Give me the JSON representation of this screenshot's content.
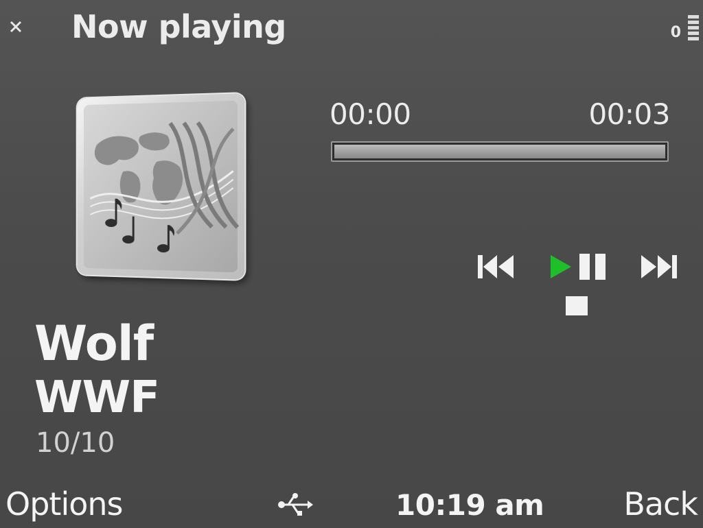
{
  "header": {
    "title": "Now playing",
    "status_indicator": "0",
    "battery_level": 1.0,
    "close_icon": "close-icon"
  },
  "player": {
    "elapsed": "00:00",
    "total": "00:03",
    "progress": 0.0,
    "album_art_icon": "album-art-music-notes-icon",
    "controls": {
      "previous_icon": "skip-previous-icon",
      "play_icon": "play-icon",
      "pause_icon": "pause-icon",
      "next_icon": "skip-next-icon",
      "stop_icon": "stop-icon"
    },
    "colors": {
      "play_accent": "#1fbf2a",
      "background": "#4a4a4a",
      "text": "#f2f2f2"
    }
  },
  "track": {
    "title": "Wolf",
    "artist": "WWF",
    "index": "10/10"
  },
  "softkeys": {
    "left": "Options",
    "right": "Back",
    "clock": "10:19 am",
    "usb_icon": "usb-icon"
  }
}
